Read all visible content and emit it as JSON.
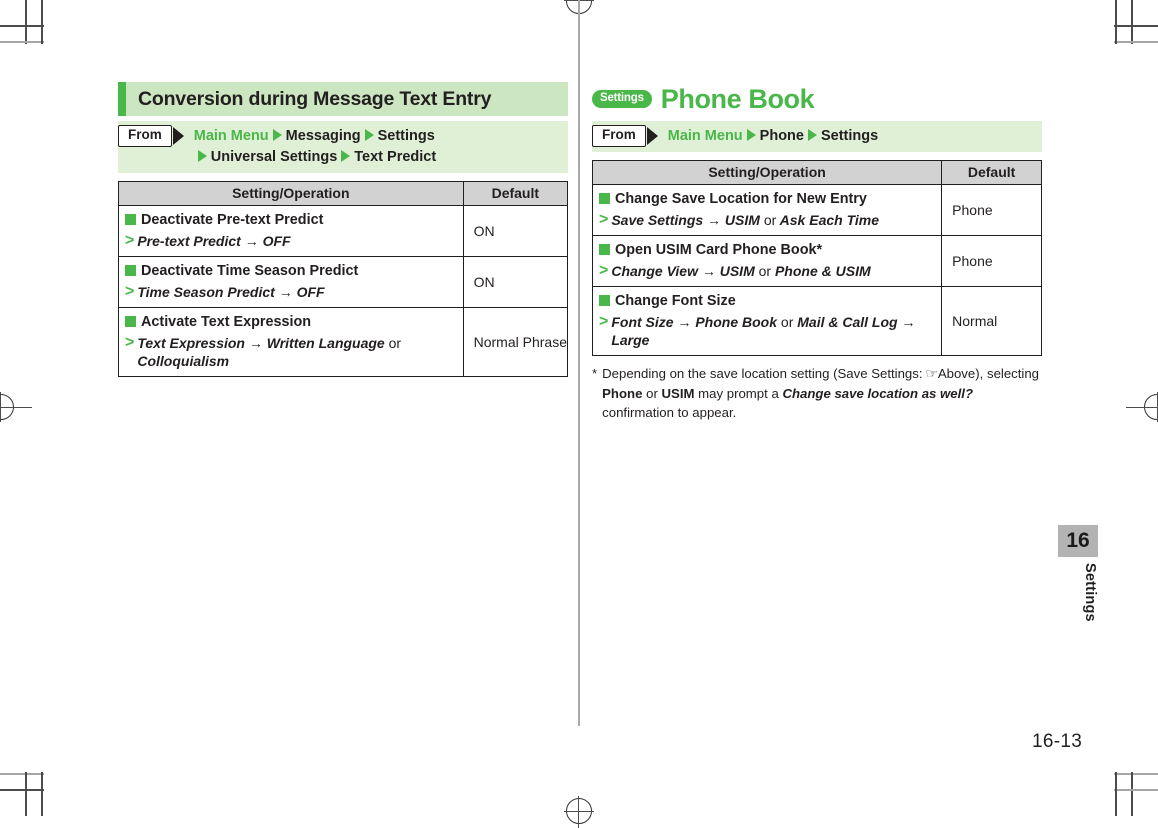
{
  "page": {
    "number": "16-13",
    "chapter_tab": {
      "number": "16",
      "label": "Settings"
    }
  },
  "left_column": {
    "heading": "Conversion during Message Text Entry",
    "from": {
      "label": "From",
      "path_line1_root": "Main Menu",
      "path_line1_items": [
        "Messaging",
        "Settings"
      ],
      "path_line2_items": [
        "Universal Settings",
        "Text Predict"
      ]
    },
    "table": {
      "headers": [
        "Setting/Operation",
        "Default"
      ],
      "rows": [
        {
          "title": "Deactivate Pre-text Predict",
          "sub": "Pre-text Predict → OFF",
          "default": "ON"
        },
        {
          "title": "Deactivate Time Season Predict",
          "sub": "Time Season Predict → OFF",
          "default": "ON"
        },
        {
          "title": "Activate Text Expression",
          "sub_a": "Text Expression → Written Language",
          "sub_or": "or",
          "sub_b": "Colloquialism",
          "default": "Normal Phrase"
        }
      ]
    }
  },
  "right_column": {
    "badge": "Settings",
    "heading": "Phone Book",
    "from": {
      "label": "From",
      "path_root": "Main Menu",
      "path_items": [
        "Phone",
        "Settings"
      ]
    },
    "table": {
      "headers": [
        "Setting/Operation",
        "Default"
      ],
      "rows": [
        {
          "title": "Change Save Location for New Entry",
          "sub_a": "Save Settings → USIM",
          "sub_or": "or",
          "sub_b": "Ask Each Time",
          "default": "Phone"
        },
        {
          "title": "Open USIM Card Phone Book*",
          "sub_a": "Change View → USIM",
          "sub_or": "or",
          "sub_b": "Phone & USIM",
          "default": "Phone"
        },
        {
          "title": "Change Font Size",
          "sub_a": "Font Size → Phone Book",
          "sub_or": "or",
          "sub_b": "Mail & Call Log →",
          "sub_c": "Large",
          "default": "Normal"
        }
      ]
    },
    "footnote": {
      "marker": "*",
      "part1": "Depending on the save location setting (Save Settings:",
      "hand_icon": "pointing-hand-icon",
      "part2": "Above),",
      "part3": "selecting",
      "bold1": "Phone",
      "part4": "or",
      "bold2": "USIM",
      "part5": "may prompt a",
      "italic1": "Change save location as well?",
      "part6": "confirmation to appear."
    }
  },
  "colors": {
    "green": "#49b749",
    "light_green": "#cbe6c0",
    "pale_green": "#dff0d6",
    "grey_header": "#d2d2d2",
    "tab_grey": "#b3b3b3",
    "ink": "#231f20"
  }
}
